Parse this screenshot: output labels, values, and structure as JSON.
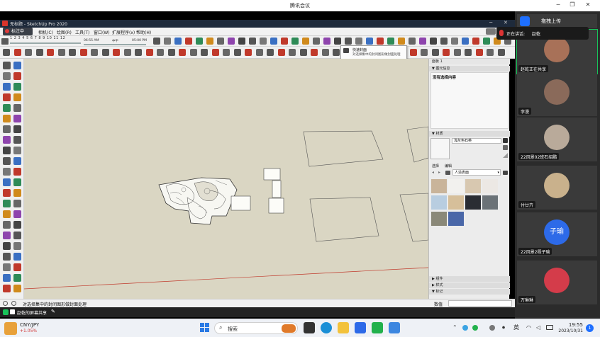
{
  "meeting": {
    "title": "腾讯会议",
    "upload_button": "拖拽上传",
    "speaking_label": "正在讲话:",
    "speaker_name": "赵乾",
    "share_notice": "赵乾的屏幕共享"
  },
  "sketchup": {
    "window_title": "无标题 - SketchUp Pro 2020",
    "annotate_button": "标注中",
    "menus": [
      "相机(C)",
      "绘图(R)",
      "工具(T)",
      "窗口(W)",
      "扩展程序(x)",
      "帮助(H)"
    ],
    "timeline": {
      "months": "1 2 3 4 5 6 7 8 9 10 11 12",
      "time_start": "06:55 AM",
      "noon": "中午",
      "time_end": "05:00 PM"
    },
    "tooltip": {
      "title": "快速封面",
      "text": "对选择集中的封闭图形做封面处理"
    },
    "status_text": "对选择集中的封闭图形做封面处理",
    "measure_label": "数值"
  },
  "tray": {
    "title": "面板 1",
    "entity_info": {
      "header": "图元信息",
      "text": "没有选择内容"
    },
    "materials": {
      "header": "材质",
      "material_name": "浅灰色石英",
      "tab_select": "选择",
      "tab_edit": "编辑",
      "library": "人造表面",
      "swatch_colors": [
        "#c9b49a",
        "#f2f1ee",
        "#d8c8b0",
        "#ece8e4",
        "#b8cde0",
        "#d6bf9a",
        "#2a2d33",
        "#6b7277",
        "#8a8878",
        "#4a67a8"
      ]
    },
    "collapsed": [
      "组件",
      "样式",
      "标记"
    ]
  },
  "participants": [
    {
      "name": "赵乾正在共享"
    },
    {
      "name": "李漫"
    },
    {
      "name": "22风景02班石绍鹏"
    },
    {
      "name": "付廿卉"
    },
    {
      "name": "22风景2程子瑜",
      "initials": "子瑜"
    },
    {
      "name": "万琳琳"
    }
  ],
  "taskbar": {
    "currency": "CNY/JPY",
    "change": "+1.05%",
    "search_placeholder": "搜索",
    "ime": "英",
    "time": "19:55",
    "date": "2023/10/31",
    "notifications": "1"
  },
  "colors": {
    "viewport_bg": "#dad6c3",
    "accent_green": "#18c35a",
    "meeting_blue": "#1e6fff"
  }
}
